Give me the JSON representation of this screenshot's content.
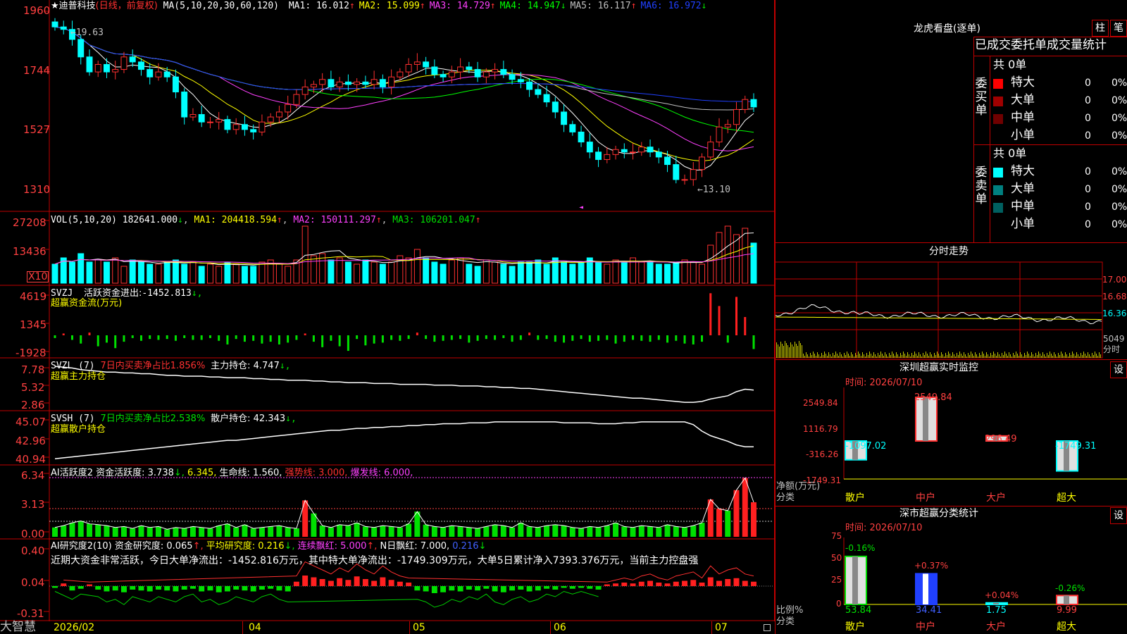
{
  "colors": {
    "up": "#ff3030",
    "down": "#00ffff",
    "vol_up": "#ff3030",
    "flow_up": "#ff2020",
    "flow_down": "#00e000",
    "border": "#c00000",
    "axis_text": "#ff4040"
  },
  "main": {
    "title": "★迪普科技",
    "mode": "(日线，前复权)",
    "ma_params": "MA(5,10,20,30,60,120)",
    "ma_items": [
      {
        "label": "MA1:",
        "value": "16.012",
        "arrow": "↑",
        "color": "#ffffff"
      },
      {
        "label": "MA2:",
        "value": "15.099",
        "arrow": "↑",
        "color": "#ffff00"
      },
      {
        "label": "MA3:",
        "value": "14.729",
        "arrow": "↑",
        "color": "#ff40ff"
      },
      {
        "label": "MA4:",
        "value": "14.947",
        "arrow": "↓",
        "color": "#00ff00"
      },
      {
        "label": "MA5:",
        "value": "16.117",
        "arrow": "↑",
        "color": "#c0c0c0"
      },
      {
        "label": "MA6:",
        "value": "16.972",
        "arrow": "↓",
        "color": "#2040ff"
      }
    ],
    "y_ticks": [
      "1960",
      "1744",
      "1527",
      "1310"
    ],
    "hi_mark": "19.63",
    "lo_mark": "13.10"
  },
  "vol": {
    "title": "VOL(5,10,20)",
    "value": "182641.000",
    "a": "↓",
    "ma1": "MA1: 204418.594",
    "ma1a": "↑",
    "ma2": "MA2: 150111.297",
    "ma2a": "↑",
    "ma3": "MA3: 106201.047",
    "ma3a": "↑",
    "y_ticks": [
      "27208",
      "13436"
    ],
    "unit": "X10"
  },
  "svzj": {
    "title": "SVZJ",
    "label": "活跃资金进出:",
    "value": "-1452.813",
    "a": "↓,",
    "sub": "超赢资金流(万元)",
    "y_ticks": [
      "4619",
      "1345",
      "-1928"
    ]
  },
  "svzl": {
    "title": "SVZL (7)",
    "ratio_label": "7日内买卖净占比1.856%",
    "hold": "主力持仓: 4.747",
    "a": "↓,",
    "sub": "超赢主力持仓",
    "y_ticks": [
      "7.78",
      "5.32",
      "2.86"
    ]
  },
  "svsh": {
    "title": "SVSH (7)",
    "ratio_label": "7日内买卖净占比2.538%",
    "hold": "散户持仓: 42.343",
    "a": "↓,",
    "sub": "超赢散户持仓",
    "y_ticks": [
      "45.07",
      "42.96",
      "40.94"
    ]
  },
  "ai1": {
    "title": "AI活跃度2",
    "l1": "资金活跃度: 3.738",
    "a1": "↓,",
    "v2": "6.345,",
    "l3": "生命线: 1.560,",
    "l4": "强势线: 3.000,",
    "l5": "爆发线: 6.000,",
    "y_ticks": [
      "6.34",
      "3.13",
      "0.00"
    ]
  },
  "ai2": {
    "title": "AI研究度2(10)",
    "l1": "资金研究度: 0.065",
    "a1": "↑,",
    "l2": "平均研究度: 0.216",
    "a2": "↓,",
    "l3": "连续飘红: 5.000",
    "a3": "↑,",
    "l4": "N日飘红: 7.000,",
    "l5": "0.216",
    "a5": "↓",
    "comment": "近期大资金非常活跃，今日大单净流出：-1452.816万元，其中特大单净流出：-1749.309万元，大单5日累计净入7393.376万元，当前主力控盘强",
    "y_ticks": [
      "0.40",
      "0.04",
      "-0.31"
    ]
  },
  "xaxis": {
    "labels": [
      "2026/02",
      "04",
      "05",
      "06",
      "07"
    ],
    "brand": "大智慧"
  },
  "right": {
    "dragon_title": "龙虎看盘(逐单)",
    "btn_zhu": "柱",
    "btn_bi": "笔",
    "order_title": "已成交委托单成交量统计",
    "buy_group": "委买单",
    "sell_group": "委卖单",
    "total_label": "共 0单",
    "rows": [
      "特大",
      "大单",
      "中单",
      "小单"
    ],
    "row_vals": [
      "0",
      "0",
      "0",
      "0"
    ],
    "row_pcts": [
      "0%",
      "0%",
      "0%",
      "0%"
    ],
    "intraday_title": "分时走势",
    "intraday_ticks": [
      "17.00",
      "16.68",
      "16.36",
      "5049"
    ],
    "intraday_unit": "分时",
    "monitor_title": "深圳超赢实时监控",
    "set_btn": "设",
    "time_label": "时间: 2026/07/10",
    "monitor_ticks": [
      "2549.84",
      "1116.79",
      "-316.26",
      "-1749.31"
    ],
    "monitor_values": [
      "-1097.02",
      "2549.84",
      "296.49",
      "-1749.31"
    ],
    "monitor_net_label": "净额(万元)",
    "class_label": "分类",
    "categories": [
      "散户",
      "中户",
      "大户",
      "超大"
    ],
    "stat_title": "深市超赢分类统计",
    "stat_ticks": [
      "75",
      "50",
      "25",
      "0"
    ],
    "stat_pcts_top": [
      "-0.16%",
      "+0.37%",
      "+0.04%",
      "-0.26%"
    ],
    "stat_values": [
      "53.84",
      "34.41",
      "1.75",
      "9.99"
    ],
    "stat_ratio_label": "比例%"
  },
  "chart_data": [
    {
      "type": "candlestick",
      "title": "迪普科技 日线",
      "ylim": [
        13.1,
        19.63
      ],
      "y_ticks": [
        "1960",
        "1744",
        "1527",
        "1310"
      ],
      "x": [
        "2026/02",
        "04",
        "05",
        "06",
        "07"
      ],
      "close": [
        19.4,
        19.3,
        18.9,
        18.2,
        17.6,
        17.9,
        17.6,
        17.7,
        18.2,
        18.0,
        17.7,
        17.4,
        17.6,
        17.4,
        16.8,
        15.8,
        15.9,
        15.6,
        15.6,
        15.7,
        15.3,
        15.5,
        15.3,
        15.2,
        15.6,
        15.8,
        16.0,
        16.3,
        16.7,
        17.0,
        17.1,
        17.3,
        17.0,
        17.2,
        17.1,
        17.2,
        17.1,
        17.3,
        17.0,
        17.4,
        17.6,
        17.9,
        18.0,
        17.8,
        17.5,
        17.4,
        17.6,
        17.8,
        17.7,
        17.4,
        17.6,
        17.7,
        17.5,
        17.3,
        17.2,
        16.9,
        16.7,
        16.4,
        16.0,
        15.5,
        15.2,
        14.8,
        14.4,
        14.1,
        14.3,
        14.5,
        14.4,
        14.4,
        14.6,
        14.4,
        14.2,
        13.9,
        13.3,
        13.3,
        13.7,
        14.2,
        14.8,
        15.4,
        15.5,
        16.1,
        16.5,
        16.2
      ]
    },
    {
      "type": "bar",
      "title": "VOL(5,10,20)",
      "values": [
        9,
        12,
        10,
        14,
        10,
        11,
        10,
        12,
        8,
        11,
        10,
        9,
        9,
        10,
        11,
        9,
        10,
        8,
        9,
        8,
        10,
        9,
        8,
        8,
        10,
        11,
        9,
        8,
        11,
        27,
        13,
        14,
        11,
        12,
        10,
        9,
        11,
        10,
        9,
        10,
        13,
        12,
        16,
        12,
        10,
        9,
        11,
        12,
        9,
        8,
        11,
        10,
        9,
        8,
        10,
        10,
        11,
        9,
        12,
        10,
        9,
        10,
        12,
        10,
        9,
        11,
        10,
        12,
        10,
        10,
        9,
        9,
        10,
        11,
        10,
        9,
        18,
        24,
        27,
        23,
        26,
        19
      ]
    },
    {
      "type": "bar",
      "title": "SVZJ 活跃资金进出",
      "values": [
        -300,
        200,
        -500,
        -900,
        300,
        -1200,
        -800,
        -1400,
        -700,
        -300,
        -600,
        -400,
        -500,
        -400,
        -600,
        -300,
        -500,
        -500,
        -300,
        -600,
        -1000,
        -400,
        -700,
        -600,
        -900,
        -700,
        -1000,
        -800,
        -500,
        200,
        -700,
        -1300,
        -600,
        -1200,
        -1700,
        -400,
        -1100,
        -900,
        -800,
        -500,
        -600,
        -400,
        300,
        -400,
        -700,
        -600,
        -500,
        -400,
        -800,
        -600,
        -400,
        -500,
        -300,
        -700,
        -500,
        300,
        -500,
        -400,
        -700,
        -800,
        -600,
        -400,
        -700,
        -600,
        -500,
        -900,
        -700,
        -500,
        -600,
        -700,
        -500,
        -800,
        -600,
        -900,
        -1000,
        -700,
        4600,
        3200,
        -800,
        4200,
        2000,
        -1500
      ]
    },
    {
      "type": "line",
      "title": "SVZL 主力持仓",
      "y": [
        7.6,
        7.5,
        7.4,
        7.2,
        7.1,
        7.0,
        6.9,
        6.9,
        6.8,
        6.8,
        6.7,
        6.7,
        6.6,
        6.5,
        6.5,
        6.4,
        6.4,
        6.4,
        6.3,
        6.3,
        6.2,
        6.2,
        6.2,
        6.1,
        6.1,
        6.0,
        6.0,
        5.9,
        5.9,
        5.9,
        5.8,
        5.8,
        5.7,
        5.7,
        5.6,
        5.6,
        5.6,
        5.5,
        5.5,
        5.5,
        5.4,
        5.4,
        5.4,
        5.4,
        5.3,
        5.3,
        5.3,
        5.2,
        5.2,
        5.2,
        5.1,
        5.1,
        5.0,
        5.0,
        4.9,
        4.9,
        4.8,
        4.7,
        4.6,
        4.5,
        4.4,
        4.3,
        4.2,
        4.1,
        4.0,
        3.9,
        3.8,
        3.7,
        3.7,
        3.6,
        3.5,
        3.4,
        3.3,
        3.2,
        3.2,
        3.3,
        3.6,
        3.8,
        4.0,
        4.5,
        4.8,
        4.7
      ]
    },
    {
      "type": "line",
      "title": "SVSH 散户持仓",
      "y": [
        41.0,
        41.1,
        41.2,
        41.3,
        41.4,
        41.5,
        41.6,
        41.7,
        41.8,
        41.9,
        42.0,
        42.1,
        42.2,
        42.3,
        42.4,
        42.5,
        42.6,
        42.7,
        42.8,
        42.9,
        43.0,
        43.0,
        43.1,
        43.2,
        43.3,
        43.4,
        43.5,
        43.6,
        43.7,
        43.8,
        43.9,
        44.0,
        44.1,
        44.1,
        44.2,
        44.3,
        44.3,
        44.4,
        44.4,
        44.5,
        44.5,
        44.6,
        44.6,
        44.7,
        44.7,
        44.8,
        44.8,
        44.8,
        44.9,
        44.9,
        44.9,
        45.0,
        45.0,
        45.0,
        45.0,
        45.0,
        45.0,
        45.0,
        45.0,
        44.9,
        44.9,
        44.9,
        44.9,
        44.8,
        44.8,
        44.8,
        44.9,
        44.9,
        45.0,
        45.0,
        45.0,
        45.0,
        45.0,
        45.0,
        44.7,
        44.0,
        43.5,
        43.2,
        42.9,
        42.5,
        42.3,
        42.3
      ]
    },
    {
      "type": "bar",
      "title": "AI活跃度2",
      "values": [
        1.0,
        1.2,
        1.5,
        1.7,
        1.4,
        1.3,
        1.2,
        1.0,
        1.1,
        0.9,
        1.2,
        1.0,
        1.1,
        0.8,
        1.0,
        0.9,
        1.1,
        1.0,
        0.9,
        1.2,
        1.4,
        1.0,
        1.3,
        0.9,
        1.0,
        1.1,
        1.2,
        1.0,
        0.9,
        3.9,
        2.5,
        1.2,
        1.0,
        1.3,
        1.2,
        1.5,
        1.1,
        1.0,
        1.2,
        1.1,
        1.0,
        1.4,
        2.7,
        1.3,
        1.1,
        1.0,
        1.2,
        1.1,
        1.0,
        0.9,
        1.1,
        1.3,
        1.2,
        1.0,
        1.5,
        1.1,
        1.0,
        1.2,
        1.3,
        1.2,
        1.0,
        0.9,
        1.1,
        1.0,
        1.2,
        1.5,
        1.1,
        1.0,
        1.2,
        1.1,
        1.0,
        1.3,
        1.1,
        1.0,
        1.2,
        1.5,
        4.0,
        3.0,
        2.8,
        5.0,
        6.3,
        3.7
      ]
    },
    {
      "type": "bar",
      "title": "AI研究度2(10)",
      "values": [
        -0.02,
        0.03,
        -0.05,
        -0.03,
        0.02,
        -0.04,
        -0.06,
        -0.05,
        -0.07,
        -0.04,
        -0.05,
        -0.06,
        -0.04,
        -0.05,
        -0.06,
        -0.04,
        -0.03,
        -0.06,
        -0.05,
        -0.07,
        -0.06,
        -0.04,
        -0.05,
        -0.06,
        -0.04,
        -0.03,
        -0.05,
        -0.06,
        0.05,
        0.12,
        0.1,
        0.08,
        0.06,
        0.09,
        0.07,
        0.11,
        0.08,
        0.06,
        0.1,
        0.07,
        0.05,
        0.04,
        -0.05,
        -0.06,
        -0.08,
        -0.07,
        -0.05,
        -0.06,
        -0.04,
        -0.05,
        -0.03,
        -0.06,
        -0.07,
        -0.05,
        -0.04,
        -0.06,
        -0.05,
        -0.03,
        -0.04,
        -0.02,
        -0.03,
        -0.02,
        -0.03,
        -0.04,
        0.02,
        0.03,
        0.04,
        0.03,
        0.05,
        0.06,
        0.04,
        0.03,
        0.05,
        0.06,
        0.07,
        0.04,
        0.1,
        0.06,
        0.08,
        0.09,
        0.06,
        0.05
      ]
    }
  ]
}
